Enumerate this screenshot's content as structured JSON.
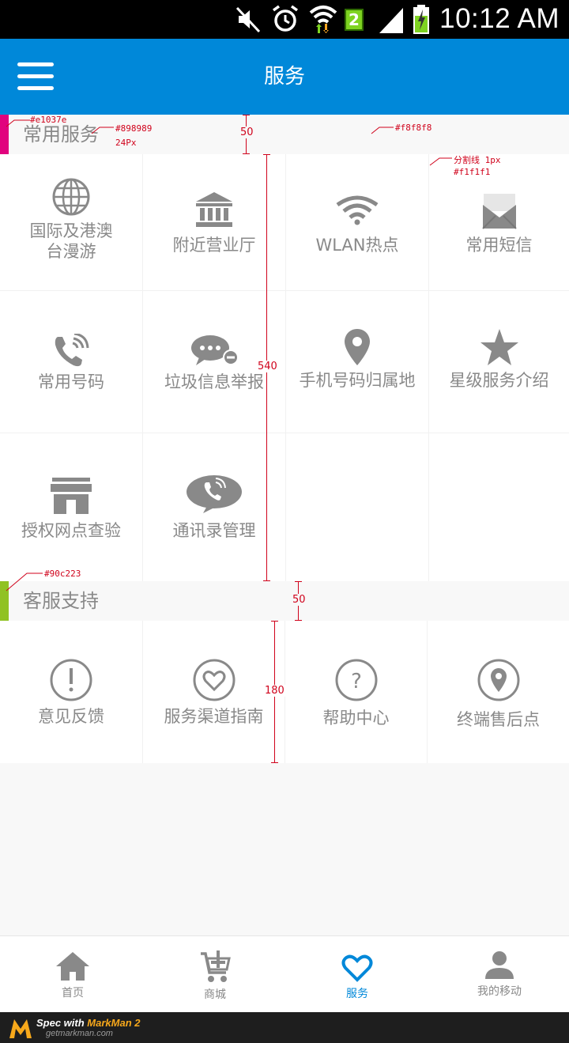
{
  "status_bar": {
    "time": "10:12 AM",
    "sim_number": "2",
    "icons": [
      "mute-icon",
      "alarm-icon",
      "wifi-icon",
      "sim-icon",
      "signal-icon",
      "battery-icon"
    ]
  },
  "app_bar": {
    "title": "服务",
    "menu_icon": "hamburger-menu-icon"
  },
  "sections": {
    "common": {
      "title": "常用服务",
      "accent": "#e1037e"
    },
    "support": {
      "title": "客服支持",
      "accent": "#90c223"
    }
  },
  "common_services": [
    {
      "label": "国际及港澳",
      "label2": "台漫游",
      "icon": "globe-icon"
    },
    {
      "label": "附近营业厅",
      "icon": "bank-icon"
    },
    {
      "label": "WLAN热点",
      "icon": "wifi-icon"
    },
    {
      "label": "常用短信",
      "icon": "envelope-icon"
    },
    {
      "label": "常用号码",
      "icon": "phone-icon"
    },
    {
      "label": "垃圾信息举报",
      "icon": "chat-block-icon"
    },
    {
      "label": "手机号码归属地",
      "icon": "location-pin-icon"
    },
    {
      "label": "星级服务介绍",
      "icon": "star-icon"
    },
    {
      "label": "授权网点查验",
      "icon": "store-icon"
    },
    {
      "label": "通讯录管理",
      "icon": "phone-bubble-icon"
    }
  ],
  "support_services": [
    {
      "label": "意见反馈",
      "icon": "exclamation-circle-icon"
    },
    {
      "label": "服务渠道指南",
      "icon": "heart-circle-icon"
    },
    {
      "label": "帮助中心",
      "icon": "question-circle-icon"
    },
    {
      "label": "终端售后点",
      "icon": "location-circle-icon"
    }
  ],
  "tabs": [
    {
      "label": "首页",
      "icon": "home-icon"
    },
    {
      "label": "商城",
      "icon": "cart-icon"
    },
    {
      "label": "服务",
      "icon": "heart-icon",
      "active": true
    },
    {
      "label": "我的移动",
      "icon": "user-icon"
    }
  ],
  "colors": {
    "primary": "#0088d9",
    "text": "#898989",
    "background": "#f8f8f8",
    "divider": "#f1f1f1",
    "annotation": "#d0021b"
  },
  "annotations": {
    "accent1": "#e1037e",
    "text_color": "#898989",
    "font_size": "24Px",
    "bg_color": "#f8f8f8",
    "divider_label": "分割线 1px",
    "divider_color": "#f1f1f1",
    "accent2": "#90c223",
    "h_header": "50",
    "h_grid": "540",
    "h_header2": "50",
    "h_grid2": "180"
  },
  "footer": {
    "brand_prefix": "Spec with ",
    "brand_name": "MarkMan 2",
    "site": "getmarkman.com"
  }
}
